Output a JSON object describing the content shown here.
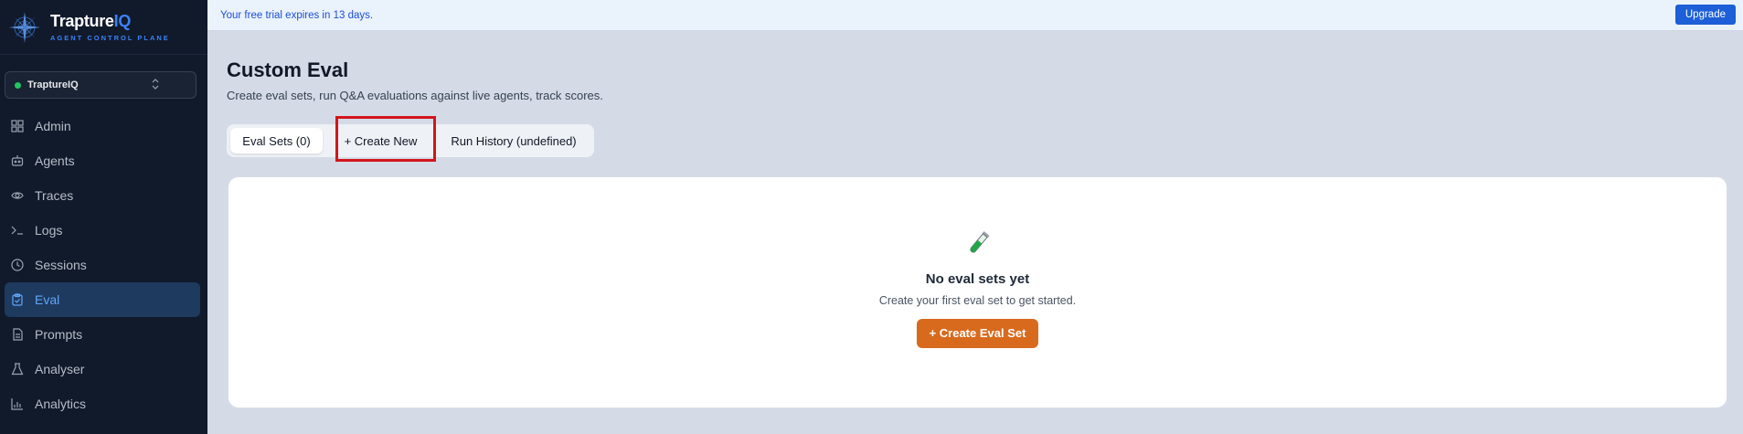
{
  "brand": {
    "name_main": "Trapture",
    "name_accent": "IQ",
    "subtitle": "AGENT CONTROL PLANE"
  },
  "org_selector": {
    "name": "TraptureIQ"
  },
  "sidebar": {
    "items": [
      {
        "label": "Admin",
        "icon": "grid-icon"
      },
      {
        "label": "Agents",
        "icon": "robot-icon"
      },
      {
        "label": "Traces",
        "icon": "eye-icon"
      },
      {
        "label": "Logs",
        "icon": "terminal-icon"
      },
      {
        "label": "Sessions",
        "icon": "clock-icon"
      },
      {
        "label": "Eval",
        "icon": "clipboard-check-icon",
        "active": true
      },
      {
        "label": "Prompts",
        "icon": "document-icon"
      },
      {
        "label": "Analyser",
        "icon": "flask-icon"
      },
      {
        "label": "Analytics",
        "icon": "bar-chart-icon"
      }
    ]
  },
  "banner": {
    "text": "Your free trial expires in 13 days.",
    "button": "Upgrade"
  },
  "page": {
    "title": "Custom Eval",
    "description": "Create eval sets, run Q&A evaluations against live agents, track scores."
  },
  "tabs": [
    {
      "label": "Eval Sets (0)",
      "active": true
    },
    {
      "label": "+ Create New",
      "active": false
    },
    {
      "label": "Run History (undefined)",
      "active": false
    }
  ],
  "empty_state": {
    "icon": "test-tube-icon",
    "title": "No eval sets yet",
    "description": "Create your first eval set to get started.",
    "button": "+ Create Eval Set"
  },
  "colors": {
    "accent": "#3b82f6",
    "cta": "#d86a1e",
    "highlight": "#d3151b",
    "sidebar_bg": "#111a2b"
  }
}
